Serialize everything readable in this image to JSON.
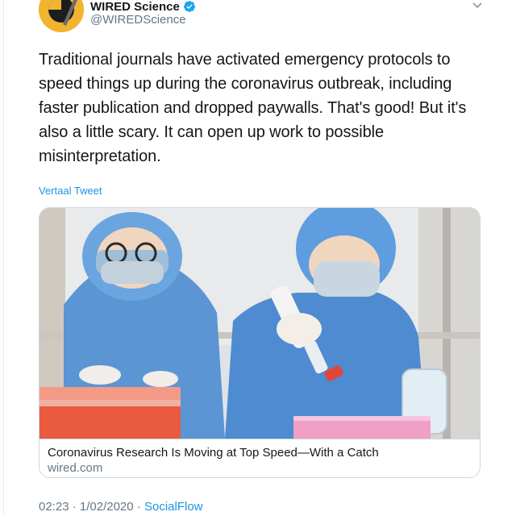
{
  "author": {
    "display_name": "WIRED Science",
    "handle": "@WIREDScience",
    "verified_icon": "verified-badge-icon",
    "avatar_color": "#f1b42f"
  },
  "tweet": {
    "text": "Traditional journals have activated emergency protocols to speed things up during the coronavirus outbreak, including faster publication and dropped paywalls. That's good! But it's also a little scary. It can open up work to possible misinterpretation.",
    "translate_label": "Vertaal Tweet"
  },
  "card": {
    "title": "Coronavirus Research Is Moving at Top Speed—With a Catch",
    "domain": "wired.com",
    "image_icon": "lab-photo"
  },
  "meta": {
    "time": "02:23",
    "date": "1/02/2020",
    "separator": "·",
    "source": "SocialFlow"
  },
  "colors": {
    "link": "#1b95e0",
    "muted": "#657786",
    "text": "#14171a",
    "border": "#ccd6dd"
  }
}
